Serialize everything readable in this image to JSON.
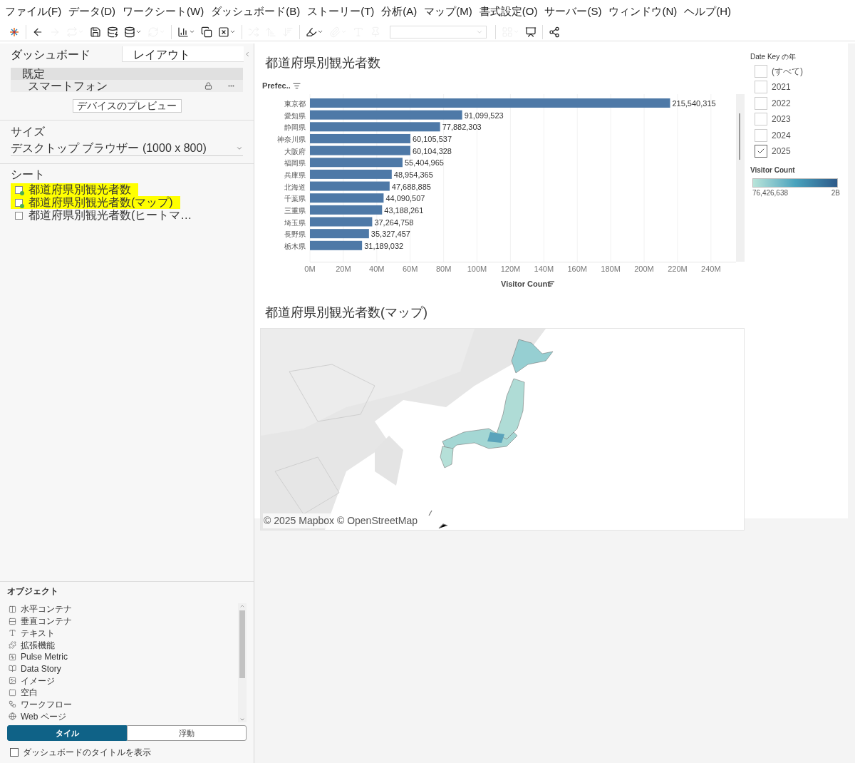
{
  "menu": [
    "ファイル(F)",
    "データ(D)",
    "ワークシート(W)",
    "ダッシュボード(B)",
    "ストーリー(T)",
    "分析(A)",
    "マップ(M)",
    "書式設定(O)",
    "サーバー(S)",
    "ウィンドウ(N)",
    "ヘルプ(H)"
  ],
  "toolbar": [
    {
      "disabled": false,
      "dropdown": false
    },
    {
      "disabled": false,
      "dropdown": false
    },
    {
      "disabled": true,
      "dropdown": false
    },
    {
      "disabled": true,
      "dropdown": true
    },
    {
      "disabled": false,
      "dropdown": false
    },
    {
      "disabled": false,
      "dropdown": false
    },
    {
      "disabled": false,
      "dropdown": true
    },
    {
      "disabled": true,
      "dropdown": true
    },
    {
      "disabled": false,
      "dropdown": true
    },
    {
      "disabled": false,
      "dropdown": false
    },
    {
      "disabled": false,
      "dropdown": true
    },
    {
      "disabled": true,
      "dropdown": false
    },
    {
      "disabled": true,
      "dropdown": false
    },
    {
      "disabled": true,
      "dropdown": false
    },
    {
      "disabled": false,
      "dropdown": true
    },
    {
      "disabled": true,
      "dropdown": true
    },
    {
      "disabled": true,
      "dropdown": false
    },
    {
      "disabled": true,
      "dropdown": false
    },
    {
      "disabled": true,
      "dropdown": true
    },
    {
      "disabled": false,
      "dropdown": false
    },
    {
      "disabled": false,
      "dropdown": false
    }
  ],
  "left_panel": {
    "tabs": [
      {
        "label": "ダッシュボード",
        "selected": true
      },
      {
        "label": "レイアウト",
        "selected": false
      }
    ],
    "devices": [
      {
        "label": "既定",
        "selected": true
      },
      {
        "label": "スマートフォン",
        "selected": false
      }
    ],
    "preview_button": "デバイスのプレビュー",
    "size": {
      "title": "サイズ",
      "value": "デスクトップ ブラウザー (1000 x 800)"
    },
    "sheets": {
      "title": "シート",
      "items": [
        {
          "label": "都道府県別観光者数",
          "highlighted": true,
          "used": true
        },
        {
          "label": "都道府県別観光者数(マップ)",
          "highlighted": true,
          "used": true
        },
        {
          "label": "都道府県別観光者数(ヒートマ…",
          "highlighted": false,
          "used": false
        }
      ]
    },
    "objects": {
      "title": "オブジェクト",
      "items": [
        "水平コンテナ",
        "垂直コンテナ",
        "テキスト",
        "拡張機能",
        "Pulse Metric",
        "Data Story",
        "イメージ",
        "空白",
        "ワークフロー",
        "Web ページ"
      ]
    },
    "placement": [
      {
        "label": "タイル",
        "selected": true
      },
      {
        "label": "浮動",
        "selected": false
      }
    ],
    "show_title": {
      "label": "ダッシュボードのタイトルを表示",
      "checked": false
    }
  },
  "bar_sheet": {
    "title": "都道府県別観光者数",
    "row_header": "Prefec..",
    "chart_data": {
      "type": "bar",
      "orientation": "horizontal",
      "xlabel": "Visitor Count",
      "grid": true,
      "xlim": [
        0,
        255000000
      ],
      "categories": [
        "東京都",
        "愛知県",
        "静岡県",
        "神奈川県",
        "大阪府",
        "福岡県",
        "兵庫県",
        "北海道",
        "千葉県",
        "三重県",
        "埼玉県",
        "長野県",
        "栃木県"
      ],
      "values": [
        215540315,
        91099523,
        77882303,
        60105537,
        60104328,
        55404965,
        48954365,
        47688885,
        44090507,
        43188261,
        37264758,
        35327457,
        31189032
      ],
      "value_labels": [
        "215,540,315",
        "91,099,523",
        "77,882,303",
        "60,105,537",
        "60,104,328",
        "55,404,965",
        "48,954,365",
        "47,688,885",
        "44,090,507",
        "43,188,261",
        "37,264,758",
        "35,327,457",
        "31,189,032"
      ],
      "xticks": [
        {
          "value": 0,
          "label": "0M"
        },
        {
          "value": 20000000,
          "label": "20M"
        },
        {
          "value": 40000000,
          "label": "40M"
        },
        {
          "value": 60000000,
          "label": "60M"
        },
        {
          "value": 80000000,
          "label": "80M"
        },
        {
          "value": 100000000,
          "label": "100M"
        },
        {
          "value": 120000000,
          "label": "120M"
        },
        {
          "value": 140000000,
          "label": "140M"
        },
        {
          "value": 160000000,
          "label": "160M"
        },
        {
          "value": 180000000,
          "label": "180M"
        },
        {
          "value": 200000000,
          "label": "200M"
        },
        {
          "value": 220000000,
          "label": "220M"
        },
        {
          "value": 240000000,
          "label": "240M"
        }
      ]
    }
  },
  "map_sheet": {
    "title": "都道府県別観光者数(マップ)",
    "attribution": "© 2025 Mapbox © OpenStreetMap"
  },
  "filter": {
    "title": "Date Key の年",
    "items": [
      {
        "label": "(すべて)",
        "checked": false
      },
      {
        "label": "2021",
        "checked": false
      },
      {
        "label": "2022",
        "checked": false
      },
      {
        "label": "2023",
        "checked": false
      },
      {
        "label": "2024",
        "checked": false
      },
      {
        "label": "2025",
        "checked": true
      }
    ]
  },
  "legend": {
    "title": "Visitor Count",
    "min": "76,426,638",
    "max": "2B"
  }
}
